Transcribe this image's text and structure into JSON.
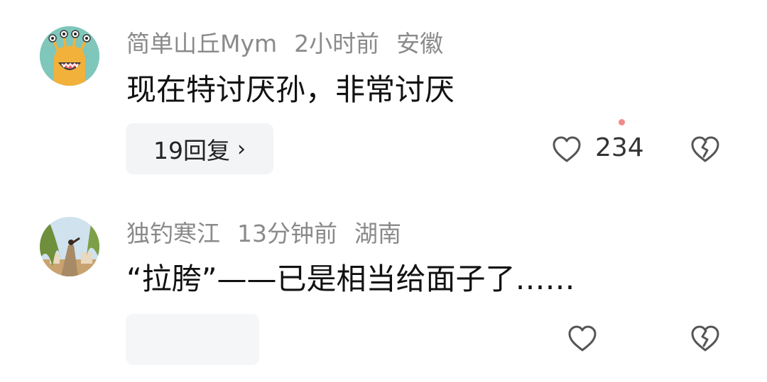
{
  "comments": [
    {
      "username": "简单山丘Mym",
      "time": "2小时前",
      "location": "安徽",
      "text": "现在特讨厌孙，非常讨厌",
      "reply_label": "19回复",
      "reply_chevron": "›",
      "like_count": "234",
      "like_icon": "heart-outline-icon",
      "dislike_icon": "broken-heart-icon",
      "avatar_colors": {
        "bg": "#7fc6bb",
        "face": "#f2b13b",
        "mouth": "#e85d5d"
      }
    },
    {
      "username": "独钓寒江",
      "time": "13分钟前",
      "location": "湖南",
      "text": "“拉胯”——已是相当给面子了……",
      "like_icon": "heart-outline-icon",
      "dislike_icon": "broken-heart-icon",
      "avatar_colors": {
        "sky": "#cfe2ee",
        "tree": "#6f8f3c",
        "ground": "#c9a36f"
      }
    }
  ],
  "colors": {
    "meta_text": "#8a8a8a",
    "body_text": "#111111",
    "reply_bg": "#f3f4f6",
    "icon_stroke": "#555555",
    "notification_dot": "#f28a8a"
  }
}
